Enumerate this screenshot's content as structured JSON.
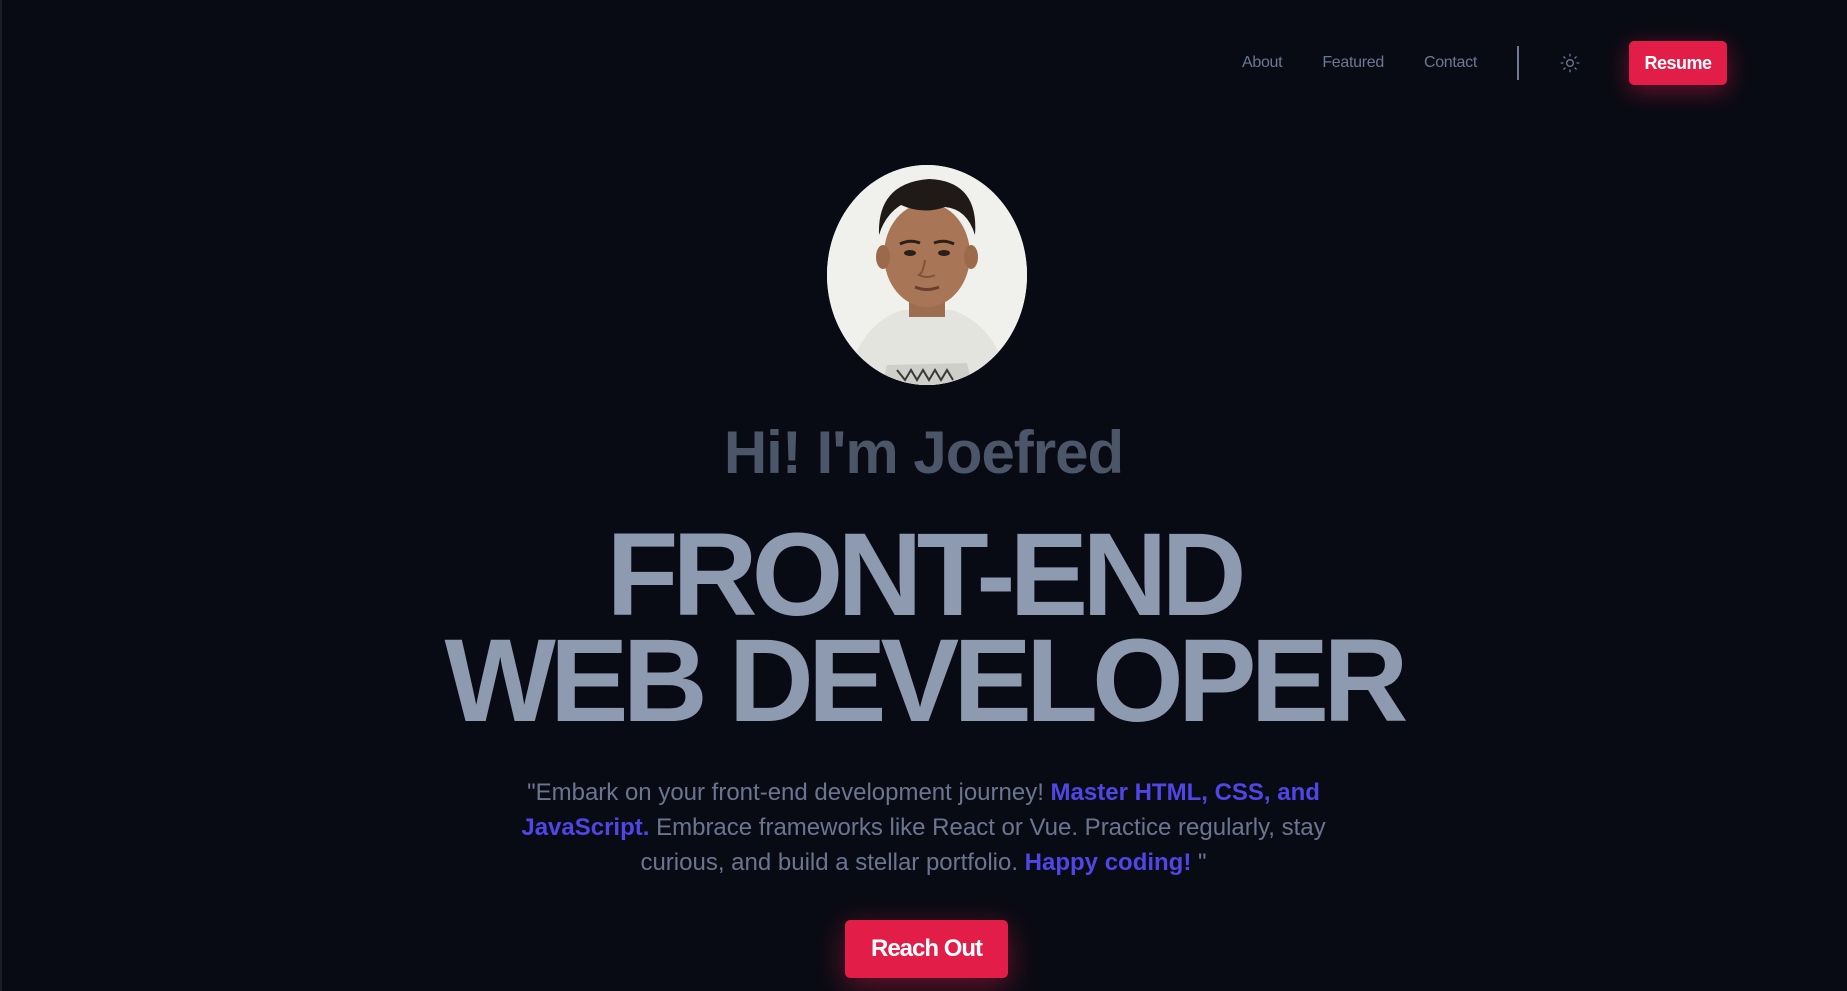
{
  "nav": {
    "links": [
      {
        "label": "About"
      },
      {
        "label": "Featured"
      },
      {
        "label": "Contact"
      }
    ],
    "theme_icon": "sun-icon",
    "resume_label": "Resume"
  },
  "hero": {
    "avatar_alt": "profile-photo",
    "greeting": "Hi! I'm Joefred",
    "title_line1": "FRONT-END",
    "title_line2": "WEB DEVELOPER",
    "quote": {
      "part1": "\"Embark on your front-end development journey! ",
      "highlight1": "Master HTML, CSS, and JavaScript.",
      "part2": " Embrace frameworks like React or Vue. Practice regularly, stay curious, and build a stellar portfolio. ",
      "highlight2": "Happy coding!",
      "part3": " \""
    },
    "cta_label": "Reach Out"
  },
  "colors": {
    "background": "#090b14",
    "accent": "#e11d48",
    "highlight": "#4f46e5",
    "title": "#8d9ab0"
  }
}
